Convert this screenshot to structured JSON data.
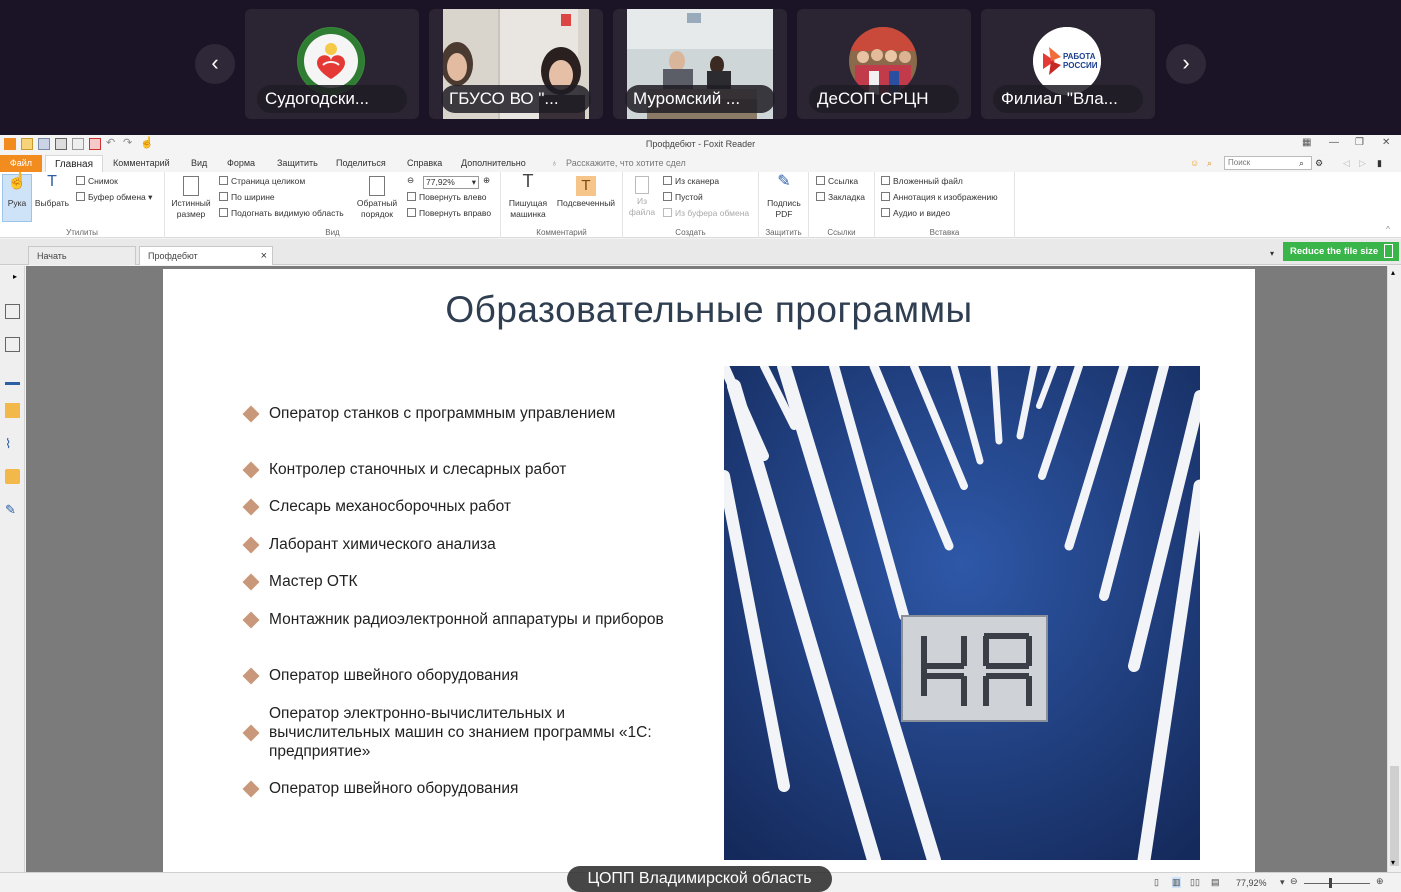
{
  "conference": {
    "tiles": [
      {
        "name": "Судогодски..."
      },
      {
        "name": "ГБУСО ВО \"..."
      },
      {
        "name": "Муромский ..."
      },
      {
        "name": "ДеСОП СРЦН"
      },
      {
        "name": "Филиал \"Вла..."
      }
    ],
    "logo_rabota_line1": "РАБОТА",
    "logo_rabota_line2": "РОССИИ",
    "nav_prev": "‹",
    "nav_next": "›",
    "caption": "ЦОПП Владимирской область"
  },
  "window": {
    "title": "Профдебют - Foxit Reader"
  },
  "menu": {
    "file": "Файл",
    "active": "Главная",
    "items": [
      "Комментарий",
      "Вид",
      "Форма",
      "Защитить",
      "Поделиться",
      "Справка",
      "Дополнительно"
    ],
    "tell_me": "Расскажите, что хотите сдел",
    "search_placeholder": "Поиск"
  },
  "ribbon": {
    "utilities": {
      "label": "Утилиты",
      "hand": "Рука",
      "select": "Выбрать",
      "snapshot": "Снимок",
      "clipboard": "Буфер обмена"
    },
    "view": {
      "label": "Вид",
      "actual_size_1": "Истинный",
      "actual_size_2": "размер",
      "fit_page": "Страница целиком",
      "fit_width": "По ширине",
      "fit_visible": "Подогнать видимую область",
      "reverse_1": "Обратный",
      "reverse_2": "порядок",
      "zoom": "77,92%",
      "rotate_left": "Повернуть влево",
      "rotate_right": "Повернуть вправо"
    },
    "comment": {
      "label": "Комментарий",
      "typewriter_1": "Пишущая",
      "typewriter_2": "машинка",
      "highlight": "Подсвеченный"
    },
    "create": {
      "label": "Создать",
      "from_file_1": "Из",
      "from_file_2": "файла",
      "scanner": "Из сканера",
      "blank": "Пустой",
      "from_clipboard": "Из буфера обмена"
    },
    "protect": {
      "label": "Защитить",
      "sign_1": "Подпись",
      "sign_2": "PDF"
    },
    "links": {
      "label": "Ссылки",
      "link": "Ссылка",
      "bookmark": "Закладка"
    },
    "insert": {
      "label": "Вставка",
      "attachment": "Вложенный файл",
      "image_annotation": "Аннотация к изображению",
      "audio_video": "Аудио и видео"
    }
  },
  "tabs": {
    "start": "Начать",
    "doc": "Профдебют",
    "close": "×"
  },
  "reduce_button": "Reduce the file size",
  "slide": {
    "title": "Образовательные программы",
    "bullets": [
      "Оператор станков с программным управлением",
      "Контролер станочных и слесарных работ",
      "Слесарь механосборочных работ",
      "Лаборант химического анализа",
      "Мастер ОТК",
      "Монтажник радиоэлектронной аппаратуры и приборов",
      "Оператор швейного оборудования",
      "Оператор электронно-вычислительных и вычислительных машин со знанием программы «1С: предприятие»",
      "Оператор швейного оборудования"
    ]
  },
  "status": {
    "zoom": "77,92%"
  }
}
